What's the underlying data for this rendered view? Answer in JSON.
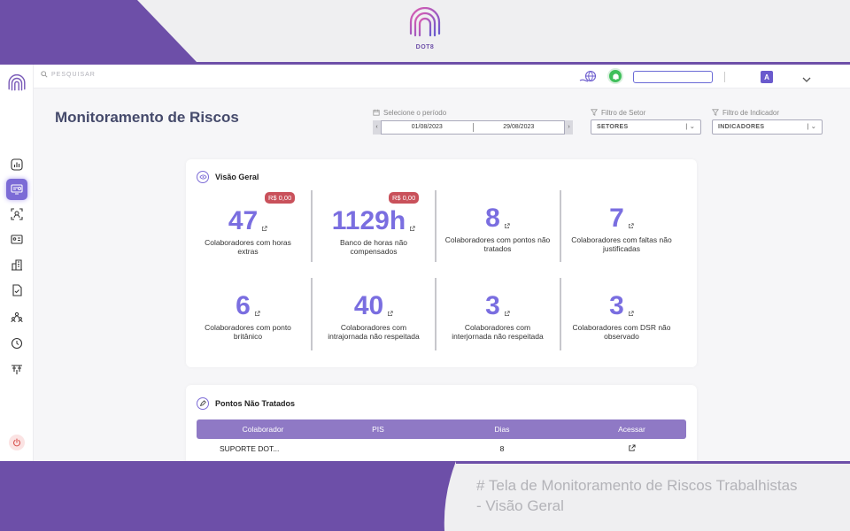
{
  "brand": {
    "name": "DOT8"
  },
  "caption": {
    "line1": "# Tela de Monitoramento de Riscos Trabalhistas",
    "line2": "- Visão Geral"
  },
  "topbar": {
    "search_placeholder": "PESQUISAR",
    "user_initial": "A"
  },
  "sidebar": {
    "items": [
      {
        "icon": "dashboard-chart-icon",
        "active": false
      },
      {
        "icon": "monitor-risks-icon",
        "active": true
      },
      {
        "icon": "face-scan-icon",
        "active": false
      },
      {
        "icon": "id-card-icon",
        "active": false
      },
      {
        "icon": "building-icon",
        "active": false
      },
      {
        "icon": "document-check-icon",
        "active": false
      },
      {
        "icon": "team-icon",
        "active": false
      },
      {
        "icon": "clock-icon",
        "active": false
      },
      {
        "icon": "org-settings-icon",
        "active": false
      }
    ]
  },
  "page": {
    "title": "Monitoramento de Riscos"
  },
  "filters": {
    "period_label": "Selecione o período",
    "date_start": "01/08/2023",
    "date_end": "29/08/2023",
    "sector_label": "Filtro de Setor",
    "sector_value": "SETORES",
    "indicator_label": "Filtro de Indicador",
    "indicator_value": "INDICADORES"
  },
  "overview": {
    "title": "Visão Geral",
    "metrics": [
      {
        "value": "47",
        "label": "Colaboradores com horas extras",
        "badge": "R$ 0,00"
      },
      {
        "value": "1129h",
        "label": "Banco de horas não compensados",
        "badge": "R$ 0,00"
      },
      {
        "value": "8",
        "label": "Colaboradores com pontos não tratados"
      },
      {
        "value": "7",
        "label": "Colaboradores com faltas não justificadas"
      },
      {
        "value": "6",
        "label": "Colaboradores com ponto britânico"
      },
      {
        "value": "40",
        "label": "Colaboradores com intrajornada não respeitada"
      },
      {
        "value": "3",
        "label": "Colaboradores com interjornada não respeitada"
      },
      {
        "value": "3",
        "label": "Colaboradores com DSR não observado"
      }
    ]
  },
  "untreated": {
    "title": "Pontos Não Tratados",
    "columns": [
      "Colaborador",
      "PIS",
      "Dias",
      "Acessar"
    ],
    "rows": [
      {
        "colaborador": "SUPORTE DOT...",
        "pis": "",
        "dias": "8"
      }
    ]
  },
  "colors": {
    "accent": "#7a6ee0",
    "frame_purple": "#6d4fa8",
    "badge": "#c9515b"
  }
}
